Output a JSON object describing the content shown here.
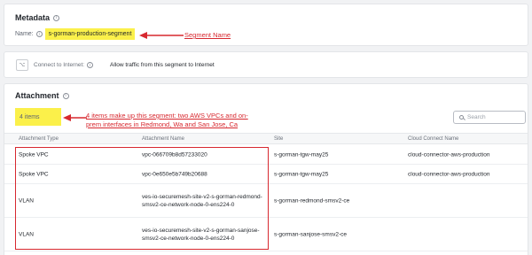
{
  "metadata": {
    "title": "Metadata",
    "name_label": "Name:",
    "name_value": "s-gorman-production-segment",
    "annotation": "Segment Name"
  },
  "connect": {
    "label": "Connect to Internet:",
    "value": "Allow traffic from this segment to Internet"
  },
  "attachment": {
    "title": "Attachment",
    "count": "4 items",
    "annotation": "4 items make up this segment: two AWS VPCs and on-prem interfaces in Redmond, Wa and San Jose, Ca",
    "search_placeholder": "Search",
    "columns": [
      "Attachment Type",
      "Attachment Name",
      "Site",
      "Cloud Connect Name"
    ],
    "rows": [
      {
        "type": "Spoke VPC",
        "name": "vpc-066709b8d57233020",
        "site": "s-gorman-tgw-may25",
        "cloud": "cloud-connector-aws-production"
      },
      {
        "type": "Spoke VPC",
        "name": "vpc-0e650e5b749b20688",
        "site": "s-gorman-tgw-may25",
        "cloud": "cloud-connector-aws-production"
      },
      {
        "type": "VLAN",
        "name": "ves-io-securemesh-site-v2-s-gorman-redmond-smsv2-ce-network-node-0-ens224-0",
        "site": "s-gorman-redmond-smsv2-ce",
        "cloud": ""
      },
      {
        "type": "VLAN",
        "name": "ves-io-securemesh-site-v2-s-gorman-sanjose-smsv2-ce-network-node-0-ens224-0",
        "site": "s-gorman-sanjose-smsv2-ce",
        "cloud": ""
      }
    ]
  },
  "colors": {
    "highlight": "#fbf04a",
    "annotation": "#d7282f"
  },
  "icons": {
    "info": "info-icon",
    "connect": "connect-icon",
    "search": "search-icon",
    "arrow": "arrow-left-icon"
  }
}
